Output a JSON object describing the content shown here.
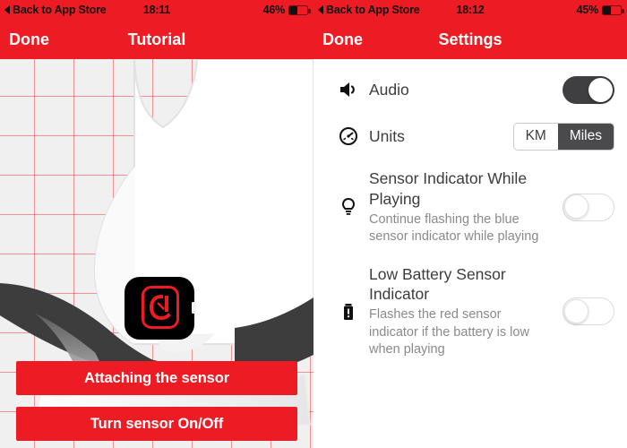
{
  "theme": {
    "red": "#ED1C24",
    "toggle_on": "#3f3f41",
    "segment_selected": "#4a4a4c"
  },
  "left": {
    "status": {
      "back_label": "Back to App Store",
      "time": "18:11",
      "battery_percent": "46%",
      "battery_level": 46
    },
    "nav": {
      "done_label": "Done",
      "title": "Tutorial"
    },
    "illustration": {
      "name": "sneaker-with-sensor",
      "device_icon": "sensor-device"
    },
    "buttons": [
      {
        "label": "Attaching the sensor",
        "name": "attaching-the-sensor-button"
      },
      {
        "label": "Turn sensor On/Off",
        "name": "turn-sensor-on-off-button"
      }
    ]
  },
  "right": {
    "status": {
      "back_label": "Back to App Store",
      "time": "18:12",
      "battery_percent": "45%",
      "battery_level": 45
    },
    "nav": {
      "done_label": "Done",
      "title": "Settings"
    },
    "rows": [
      {
        "icon": "speaker-icon",
        "title": "Audio",
        "subtitle": "",
        "control": "toggle",
        "value": "on"
      },
      {
        "icon": "speedometer-icon",
        "title": "Units",
        "subtitle": "",
        "control": "segmented",
        "options": [
          "KM",
          "Miles"
        ],
        "value": "Miles"
      },
      {
        "icon": "lightbulb-icon",
        "title": "Sensor Indicator While Playing",
        "subtitle": "Continue flashing the blue sensor indicator while playing",
        "control": "toggle",
        "value": "off"
      },
      {
        "icon": "battery-alert-icon",
        "title": "Low Battery Sensor Indicator",
        "subtitle": "Flashes the red sensor indicator if the battery is low when playing",
        "control": "toggle",
        "value": "off"
      }
    ]
  }
}
